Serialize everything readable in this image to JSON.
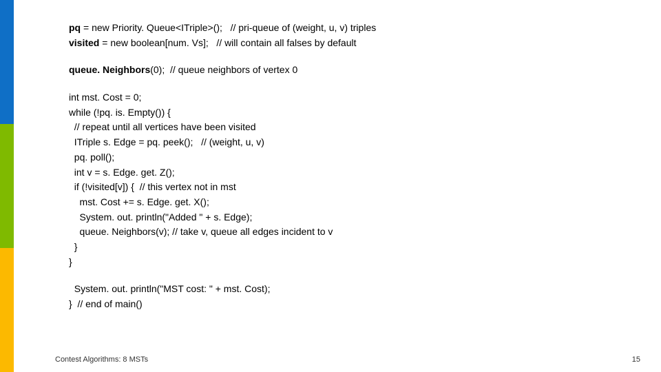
{
  "code": {
    "l1a": "pq",
    "l1b": " = new Priority. Queue<ITriple>();   // pri-queue of (weight, u, v) triples",
    "l2a": "visited",
    "l2b": " = new boolean[num. Vs];   // will contain all falses by default",
    "l3a": "queue. Neighbors",
    "l3b": "(0);  // queue neighbors of vertex 0",
    "l4": "int mst. Cost = 0;",
    "l5": "while (!pq. is. Empty()) {",
    "l6": "  // repeat until all vertices have been visited",
    "l7": "  ITriple s. Edge = pq. peek();   // (weight, u, v)",
    "l8": "  pq. poll();",
    "l9": "  int v = s. Edge. get. Z();",
    "l10": "  if (!visited[v]) {  // this vertex not in mst",
    "l11": "    mst. Cost += s. Edge. get. X();",
    "l12": "    System. out. println(\"Added \" + s. Edge);",
    "l13": "    queue. Neighbors(v); // take v, queue all edges incident to v",
    "l14": "  }",
    "l15": "}",
    "l16": "  System. out. println(\"MST cost: \" + mst. Cost);",
    "l17": "}  // end of main()"
  },
  "footer": {
    "left": "Contest Algorithms: 8 MSTs",
    "right": "15"
  }
}
